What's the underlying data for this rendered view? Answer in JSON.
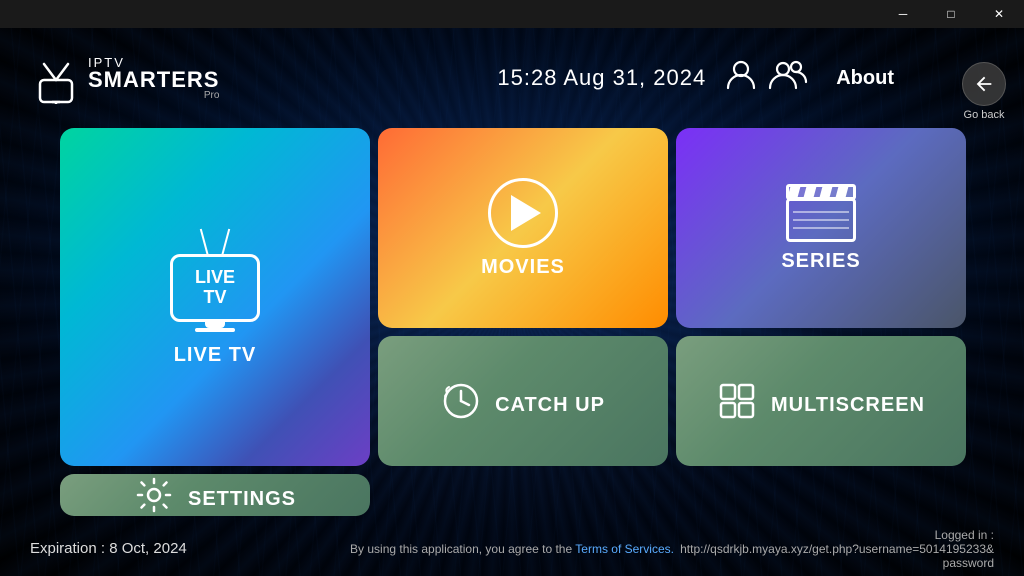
{
  "titlebar": {
    "minimize_label": "─",
    "maximize_label": "□",
    "close_label": "✕"
  },
  "goback": {
    "label": "Go back"
  },
  "header": {
    "logo_iptv": "IPTV",
    "logo_smarters": "SMARTERS",
    "logo_pro": "Pro",
    "datetime": "15:28   Aug 31, 2024",
    "about_label": "About"
  },
  "cards": {
    "livetv_label": "LIVE TV",
    "livetv_inner": "LIVE\nTV",
    "movies_label": "MOVIES",
    "series_label": "SERIES",
    "catchup_label": "CATCH UP",
    "multiscreen_label": "MULTISCREEN",
    "settings_label": "SETTINGS"
  },
  "footer": {
    "expiry_label": "Expiration : 8 Oct, 2024",
    "terms_text": "By using this application, you agree to the ",
    "terms_link": "Terms of Services.",
    "logged_in_label": "Logged in :",
    "logged_in_url": "http://qsdrkjb.myaya.xyz/get.php?username=5014195233&password"
  }
}
